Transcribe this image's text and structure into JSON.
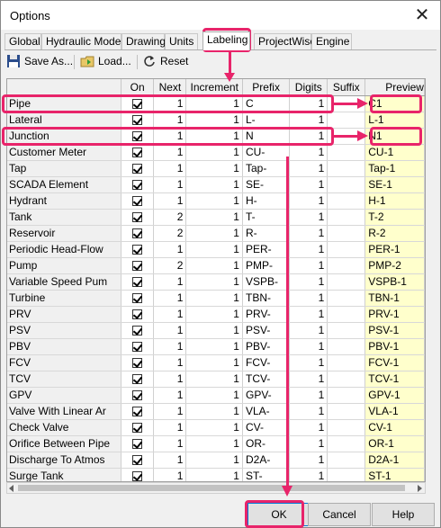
{
  "window": {
    "title": "Options",
    "close_glyph": "✕"
  },
  "tabs": [
    "Global",
    "Hydraulic Model",
    "Drawing",
    "Units",
    "Labeling",
    "ProjectWise",
    "Engine"
  ],
  "active_tab": "Labeling",
  "toolbar": {
    "save_label": "Save As...",
    "load_label": "Load...",
    "reset_label": "Reset",
    "save_icon": "save-icon",
    "load_icon": "load-icon",
    "reset_icon": "reset-icon"
  },
  "columns": {
    "name": "",
    "on": "On",
    "next": "Next",
    "increment": "Increment",
    "prefix": "Prefix",
    "digits": "Digits",
    "suffix": "Suffix",
    "preview": "Preview"
  },
  "rows": [
    {
      "name": "Pipe",
      "on": true,
      "next": "1",
      "increment": "1",
      "prefix": "C",
      "digits": "1",
      "suffix": "",
      "preview": "C1"
    },
    {
      "name": "Lateral",
      "on": true,
      "next": "1",
      "increment": "1",
      "prefix": "L-",
      "digits": "1",
      "suffix": "",
      "preview": "L-1"
    },
    {
      "name": "Junction",
      "on": true,
      "next": "1",
      "increment": "1",
      "prefix": "N",
      "digits": "1",
      "suffix": "",
      "preview": "N1"
    },
    {
      "name": "Customer Meter",
      "on": true,
      "next": "1",
      "increment": "1",
      "prefix": "CU-",
      "digits": "1",
      "suffix": "",
      "preview": "CU-1"
    },
    {
      "name": "Tap",
      "on": true,
      "next": "1",
      "increment": "1",
      "prefix": "Tap-",
      "digits": "1",
      "suffix": "",
      "preview": "Tap-1"
    },
    {
      "name": "SCADA Element",
      "on": true,
      "next": "1",
      "increment": "1",
      "prefix": "SE-",
      "digits": "1",
      "suffix": "",
      "preview": "SE-1"
    },
    {
      "name": "Hydrant",
      "on": true,
      "next": "1",
      "increment": "1",
      "prefix": "H-",
      "digits": "1",
      "suffix": "",
      "preview": "H-1"
    },
    {
      "name": "Tank",
      "on": true,
      "next": "2",
      "increment": "1",
      "prefix": "T-",
      "digits": "1",
      "suffix": "",
      "preview": "T-2"
    },
    {
      "name": "Reservoir",
      "on": true,
      "next": "2",
      "increment": "1",
      "prefix": "R-",
      "digits": "1",
      "suffix": "",
      "preview": "R-2"
    },
    {
      "name": "Periodic Head-Flow",
      "on": true,
      "next": "1",
      "increment": "1",
      "prefix": "PER-",
      "digits": "1",
      "suffix": "",
      "preview": "PER-1"
    },
    {
      "name": "Pump",
      "on": true,
      "next": "2",
      "increment": "1",
      "prefix": "PMP-",
      "digits": "1",
      "suffix": "",
      "preview": "PMP-2"
    },
    {
      "name": "Variable Speed Pum",
      "on": true,
      "next": "1",
      "increment": "1",
      "prefix": "VSPB-",
      "digits": "1",
      "suffix": "",
      "preview": "VSPB-1"
    },
    {
      "name": "Turbine",
      "on": true,
      "next": "1",
      "increment": "1",
      "prefix": "TBN-",
      "digits": "1",
      "suffix": "",
      "preview": "TBN-1"
    },
    {
      "name": "PRV",
      "on": true,
      "next": "1",
      "increment": "1",
      "prefix": "PRV-",
      "digits": "1",
      "suffix": "",
      "preview": "PRV-1"
    },
    {
      "name": "PSV",
      "on": true,
      "next": "1",
      "increment": "1",
      "prefix": "PSV-",
      "digits": "1",
      "suffix": "",
      "preview": "PSV-1"
    },
    {
      "name": "PBV",
      "on": true,
      "next": "1",
      "increment": "1",
      "prefix": "PBV-",
      "digits": "1",
      "suffix": "",
      "preview": "PBV-1"
    },
    {
      "name": "FCV",
      "on": true,
      "next": "1",
      "increment": "1",
      "prefix": "FCV-",
      "digits": "1",
      "suffix": "",
      "preview": "FCV-1"
    },
    {
      "name": "TCV",
      "on": true,
      "next": "1",
      "increment": "1",
      "prefix": "TCV-",
      "digits": "1",
      "suffix": "",
      "preview": "TCV-1"
    },
    {
      "name": "GPV",
      "on": true,
      "next": "1",
      "increment": "1",
      "prefix": "GPV-",
      "digits": "1",
      "suffix": "",
      "preview": "GPV-1"
    },
    {
      "name": "Valve With Linear Ar",
      "on": true,
      "next": "1",
      "increment": "1",
      "prefix": "VLA-",
      "digits": "1",
      "suffix": "",
      "preview": "VLA-1"
    },
    {
      "name": "Check Valve",
      "on": true,
      "next": "1",
      "increment": "1",
      "prefix": "CV-",
      "digits": "1",
      "suffix": "",
      "preview": "CV-1"
    },
    {
      "name": "Orifice Between Pipe",
      "on": true,
      "next": "1",
      "increment": "1",
      "prefix": "OR-",
      "digits": "1",
      "suffix": "",
      "preview": "OR-1"
    },
    {
      "name": "Discharge To Atmos",
      "on": true,
      "next": "1",
      "increment": "1",
      "prefix": "D2A-",
      "digits": "1",
      "suffix": "",
      "preview": "D2A-1"
    },
    {
      "name": "Surge Tank",
      "on": true,
      "next": "1",
      "increment": "1",
      "prefix": "ST-",
      "digits": "1",
      "suffix": "",
      "preview": "ST-1"
    }
  ],
  "buttons": {
    "ok": "OK",
    "cancel": "Cancel",
    "help": "Help"
  },
  "colors": {
    "annotation": "#e8246a",
    "preview_bg": "#ffffcc",
    "focus_border": "#0078d7"
  }
}
